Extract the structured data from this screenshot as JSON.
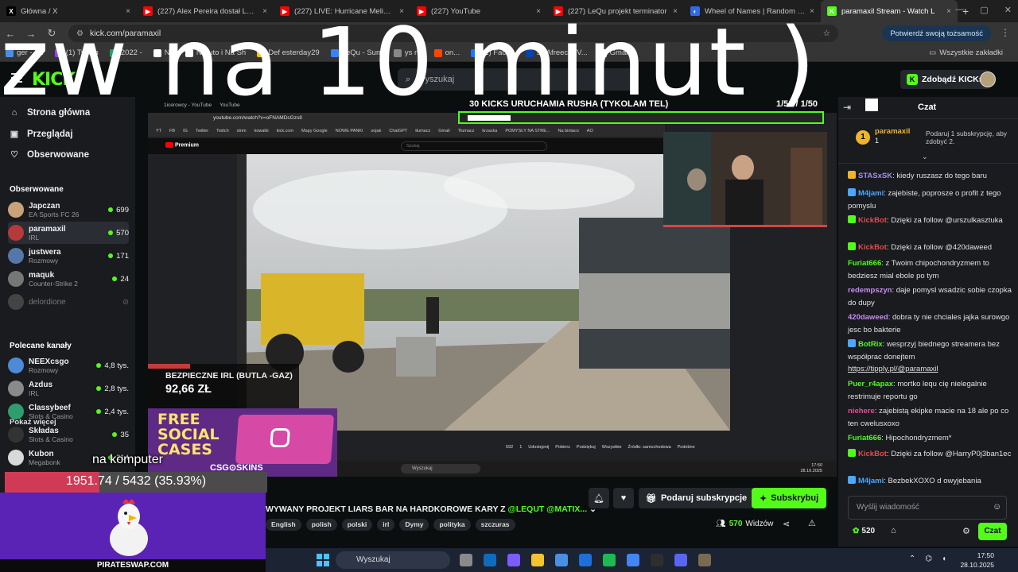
{
  "browser": {
    "tabs": [
      {
        "title": "Główna / X",
        "color": "#000000",
        "glyph": "X"
      },
      {
        "title": "(227) Alex Pereira dostał LEKCJĘ",
        "color": "#ff0000",
        "glyph": "▶"
      },
      {
        "title": "(227) LIVE: Hurricane Melissa b",
        "color": "#ff0000",
        "glyph": "▶"
      },
      {
        "title": "(227) YouTube",
        "color": "#ff0000",
        "glyph": "▶"
      },
      {
        "title": "(227) LeQu projekt terminator",
        "color": "#ff0000",
        "glyph": "▶"
      },
      {
        "title": "Wheel of Names | Random nam",
        "color": "#3369e8",
        "glyph": "◐"
      },
      {
        "title": "paramaxil Stream - Watch L",
        "color": "#53fc18",
        "glyph": "K"
      }
    ],
    "new_tab": "+",
    "url": "kick.com/paramaxil",
    "verify_label": "Potwierdź swoją tożsamość",
    "bookmarks": [
      {
        "label": "ger - Su",
        "color": "#4a90e2"
      },
      {
        "label": "(1) Twitch",
        "color": "#9146ff"
      },
      {
        "label": "2022 -",
        "color": "#1fa463"
      },
      {
        "label": "Na",
        "color": "#ffffff"
      },
      {
        "label": "Naruto i Na  Sh",
        "color": "#ffffff"
      },
      {
        "label": "Def  esterday29",
        "color": "#f5c518"
      },
      {
        "label": "LeQu - Sum",
        "color": "#3b82f6"
      },
      {
        "label": "ys na",
        "color": "#888888"
      },
      {
        "label": "on...",
        "color": "#ff4500"
      },
      {
        "label": "(1) Faceb",
        "color": "#1877f2"
      },
      {
        "label": "s | AfreecaTV...",
        "color": "#0545b1"
      },
      {
        "label": "Gmail",
        "color": "#ffffff"
      }
    ],
    "all_bookmarks": "Wszystkie zakładki"
  },
  "kick": {
    "logo": "KICK",
    "search_placeholder": "Wyszukaj",
    "kicks_button": "Zdobądź KICKs"
  },
  "sidebar": {
    "nav": [
      {
        "label": "Strona główna",
        "icon": "⌂"
      },
      {
        "label": "Przeglądaj",
        "icon": "▣"
      },
      {
        "label": "Obserwowane",
        "icon": "♡"
      }
    ],
    "followed_header": "Obserwowane",
    "followed": [
      {
        "name": "Japczan",
        "category": "EA Sports FC 26",
        "viewers": "699",
        "avatar": "#c9a27a"
      },
      {
        "name": "paramaxil",
        "category": "IRL",
        "viewers": "570",
        "avatar": "#b53a3a"
      },
      {
        "name": "justwera",
        "category": "Rozmowy",
        "viewers": "171",
        "avatar": "#5577aa"
      },
      {
        "name": "maquk",
        "category": "Counter-Strike 2",
        "viewers": "24",
        "avatar": "#777777"
      },
      {
        "name": "delordione",
        "category": "",
        "viewers": "",
        "avatar": "#444444"
      }
    ],
    "show_more": "Pokaż więcej",
    "recommended_header": "Polecane kanały",
    "recommended": [
      {
        "name": "NEEXcsgo",
        "category": "Rozmowy",
        "viewers": "4,8 tys.",
        "avatar": "#4d8bd6"
      },
      {
        "name": "Azdus",
        "category": "IRL",
        "viewers": "2,8 tys.",
        "avatar": "#8a8a8a"
      },
      {
        "name": "Classybeef",
        "category": "Slots & Casino",
        "viewers": "2,4 tys.",
        "avatar": "#2f9e6e"
      },
      {
        "name": "Składas",
        "category": "Slots & Casino",
        "viewers": "35",
        "avatar": "#333333"
      },
      {
        "name": "Kubon",
        "category": "Megabonk",
        "viewers": "214",
        "avatar": "#d9d9d9"
      }
    ]
  },
  "video": {
    "overlay_title": "30 KICKS URUCHAMIA RUSHA (TYKOLAM TEL)",
    "overlay_count": "1/51 / 1/50",
    "inner_url": "youtube.com/watch?v=oFNAMDcGzs8",
    "inner_tabs": [
      "1icerowcy - YouTube",
      "YouTube"
    ],
    "inner_bookmarks": [
      "YT",
      "FB",
      "IG",
      "Twitter",
      "Twitch",
      "stnm",
      "kowalki",
      "kick.com",
      "Mapy Google",
      "NOWE PANKI",
      "sojak",
      "ChatGPT",
      "tłumacz",
      "Gmail",
      "Tłumacz",
      "krzacka",
      "POMYSŁY NA STRE...",
      "Na bintaco",
      "AO"
    ],
    "yt_logo": "Premium",
    "yt_search": "Szukaj",
    "yt_bottom": [
      "592",
      "1",
      "Udostępnij",
      "Pobierz",
      "Podziękuj",
      "Wszystkie",
      "Źródło: samochodowa",
      "Podobne"
    ],
    "inner_search": "Wyszukaj",
    "inner_time": "17:50",
    "inner_date": "28.10.2025"
  },
  "donation": {
    "title": "BEZPIECZNE IRL (BUTLA -GAZ)",
    "amount": "92,66 ZŁ",
    "fill": 0.28
  },
  "promo": {
    "line1": "FREE",
    "line2": "SOCIAL",
    "line3": "CASES",
    "brand": "CSG⊙SKINS"
  },
  "overlay_text": {
    "big": "zw na 10 minut )",
    "pc_label": "na komputer",
    "progress_text": "1951.74 / 5432 (35.93%)",
    "progress_fraction": 0.3593,
    "pirate_label": "PIRATESWAP.COM"
  },
  "stream": {
    "title_prefix": "WYWANY PROJEKT LIARS BAR NA HARDKOROWE KARY Z ",
    "mention1": "@LEQUT",
    "mention2": "@MATIX...",
    "tags": [
      "English",
      "polish",
      "polski",
      "irl",
      "Dymy",
      "polityka",
      "szczuras"
    ],
    "gift_sub": "Podaruj subskrypcje",
    "subscribe": "Subskrybuj",
    "viewers": "570",
    "viewers_label": "Widzów"
  },
  "chat": {
    "title": "Czat",
    "pinned": {
      "user": "paramaxil",
      "num": "1",
      "text": "Podaruj 1 subskrypcję, aby zdobyć 2."
    },
    "messages": [
      {
        "user": "STASxSK",
        "color": "#a48cf2",
        "badge": "#f0b429",
        "text": "kiedy ruszasz do tego baru"
      },
      {
        "user": "M4jami",
        "color": "#4aa8ff",
        "badge": "#4aa8ff",
        "text": "zajebiste, poprosze o profit z tego pomyslu"
      },
      {
        "user": "KickBot",
        "color": "#e34c4c",
        "badge": "#53fc18",
        "text": "Dzięki za follow @urszulkasztuka"
      },
      {
        "user": "KickBot",
        "color": "#e34c4c",
        "badge": "#53fc18",
        "text": "Dzięki za follow @420daweed"
      },
      {
        "user": "Furiat666",
        "color": "#53fc18",
        "badge": "",
        "text": "z Twoim chipochondryzmem to bedziesz mial ebole po tym"
      },
      {
        "user": "redempszyn",
        "color": "#c78cf2",
        "badge": "",
        "text": "daje pomysl wsadzic sobie czopka do dupy"
      },
      {
        "user": "420daweed",
        "color": "#c78cf2",
        "badge": "",
        "text": "dobra ty nie chciales jajka surowgo jesc bo bakterie"
      },
      {
        "user": "BotRix",
        "color": "#53fc18",
        "badge": "#4aa8ff",
        "text": "wesprzyj biednego streamera bez współprac donejtem",
        "link": "https://tipply.pl/@paramaxil"
      },
      {
        "user": "Puer_r4apax",
        "color": "#53fc18",
        "badge": "",
        "text": "mortko lequ cię nielegalnie restrimuje reportu go"
      },
      {
        "user": "niehere",
        "color": "#e34c9c",
        "badge": "",
        "text": "zajebistą ekipke macie na 18 ale po co ten cwelusxoxo"
      },
      {
        "user": "Furiat666",
        "color": "#53fc18",
        "badge": "",
        "text": "Hipochondryzmem*"
      },
      {
        "user": "KickBot",
        "color": "#e34c4c",
        "badge": "#53fc18",
        "text": "Dzięki za follow @HarryP0j3ban1ec"
      },
      {
        "user": "M4jami",
        "color": "#4aa8ff",
        "badge": "#4aa8ff",
        "text": "BezbekXOXO d owyjebania"
      }
    ],
    "input_placeholder": "Wyślij wiadomość",
    "points": "520",
    "send": "Czat"
  },
  "taskbar": {
    "search": "Wyszukaj",
    "time": "17:50",
    "date": "28.10.2025"
  }
}
